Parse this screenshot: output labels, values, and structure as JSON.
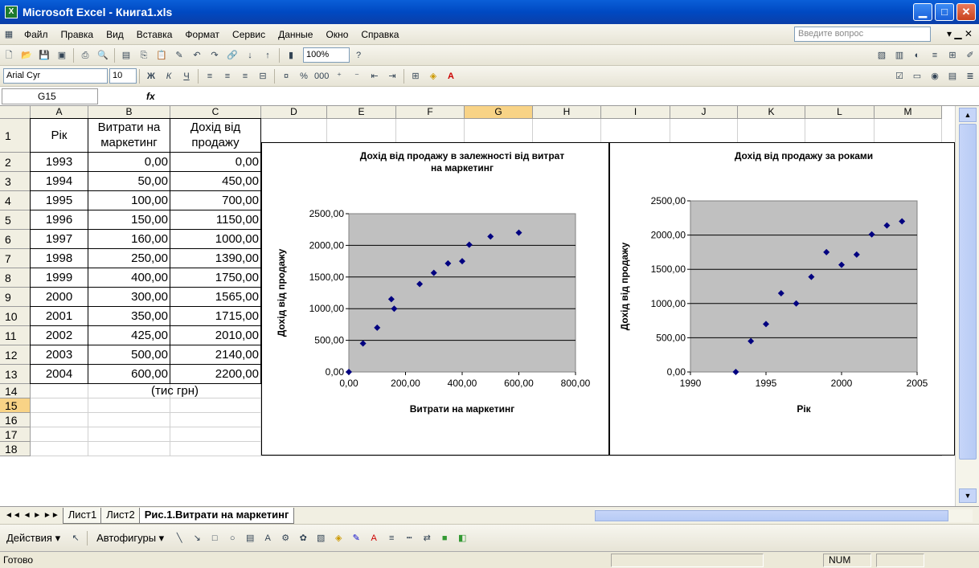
{
  "window": {
    "title": "Microsoft Excel - Книга1.xls",
    "app_icon": "X"
  },
  "menu": [
    "Файл",
    "Правка",
    "Вид",
    "Вставка",
    "Формат",
    "Сервис",
    "Данные",
    "Окно",
    "Справка"
  ],
  "ask_placeholder": "Введите вопрос",
  "toolbar": {
    "zoom": "100%",
    "font": "Arial Cyr",
    "size": "10"
  },
  "namebox": "G15",
  "fx": "fx",
  "columns": [
    "A",
    "B",
    "C",
    "D",
    "E",
    "F",
    "G",
    "H",
    "I",
    "J",
    "K",
    "L",
    "M"
  ],
  "rows": [
    "1",
    "2",
    "3",
    "4",
    "5",
    "6",
    "7",
    "8",
    "9",
    "10",
    "11",
    "12",
    "13",
    "14",
    "15",
    "16",
    "17",
    "18"
  ],
  "headers": {
    "a1": "Рік",
    "b1": "Витрати на маркетинг",
    "c1": "Дохід від продажу"
  },
  "table": [
    [
      "1993",
      "0,00",
      "0,00"
    ],
    [
      "1994",
      "50,00",
      "450,00"
    ],
    [
      "1995",
      "100,00",
      "700,00"
    ],
    [
      "1996",
      "150,00",
      "1150,00"
    ],
    [
      "1997",
      "160,00",
      "1000,00"
    ],
    [
      "1998",
      "250,00",
      "1390,00"
    ],
    [
      "1999",
      "400,00",
      "1750,00"
    ],
    [
      "2000",
      "300,00",
      "1565,00"
    ],
    [
      "2001",
      "350,00",
      "1715,00"
    ],
    [
      "2002",
      "425,00",
      "2010,00"
    ],
    [
      "2003",
      "500,00",
      "2140,00"
    ],
    [
      "2004",
      "600,00",
      "2200,00"
    ]
  ],
  "note_b14": "(тис грн)",
  "chart_data": [
    {
      "type": "scatter",
      "title": "Дохід від продажу в залежності від витрат на маркетинг",
      "xlabel": "Витрати на маркетинг",
      "ylabel": "Дохід від продажу",
      "xlim": [
        0,
        800
      ],
      "ylim": [
        0,
        2500
      ],
      "xticks": [
        "0,00",
        "200,00",
        "400,00",
        "600,00",
        "800,00"
      ],
      "yticks": [
        "0,00",
        "500,00",
        "1000,00",
        "1500,00",
        "2000,00",
        "2500,00"
      ],
      "x": [
        0,
        50,
        100,
        150,
        160,
        250,
        400,
        300,
        350,
        425,
        500,
        600
      ],
      "y": [
        0,
        450,
        700,
        1150,
        1000,
        1390,
        1750,
        1565,
        1715,
        2010,
        2140,
        2200
      ],
      "plot_color": "#c0c0c0",
      "marker_color": "#000080"
    },
    {
      "type": "scatter",
      "title": "Дохід від продажу за роками",
      "xlabel": "Рік",
      "ylabel": "Дохід від продажу",
      "xlim": [
        1990,
        2005
      ],
      "ylim": [
        0,
        2500
      ],
      "xticks": [
        "1990",
        "1995",
        "2000",
        "2005"
      ],
      "yticks": [
        "0,00",
        "500,00",
        "1000,00",
        "1500,00",
        "2000,00",
        "2500,00"
      ],
      "x": [
        1993,
        1994,
        1995,
        1996,
        1997,
        1998,
        1999,
        2000,
        2001,
        2002,
        2003,
        2004
      ],
      "y": [
        0,
        450,
        700,
        1150,
        1000,
        1390,
        1750,
        1565,
        1715,
        2010,
        2140,
        2200
      ],
      "plot_color": "#c0c0c0",
      "marker_color": "#000080"
    }
  ],
  "sheets": [
    "Лист1",
    "Лист2",
    "Рис.1.Витрати на маркетинг"
  ],
  "drawbar": {
    "actions": "Действия ▾",
    "autoshapes": "Автофигуры ▾"
  },
  "status": {
    "ready": "Готово",
    "num": "NUM"
  }
}
